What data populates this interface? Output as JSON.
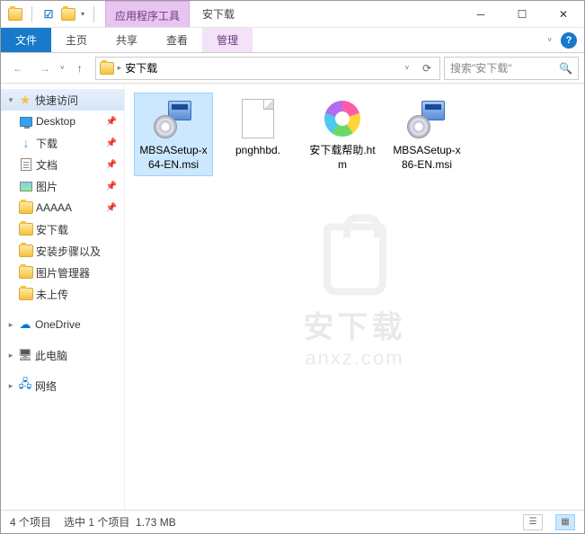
{
  "titlebar": {
    "context_label": "应用程序工具",
    "title": "安下载"
  },
  "ribbon": {
    "file": "文件",
    "home": "主页",
    "share": "共享",
    "view": "查看",
    "manage": "管理"
  },
  "nav": {
    "location": "安下载",
    "search_placeholder": "搜索\"安下载\""
  },
  "sidebar": {
    "quick": "快速访问",
    "items": [
      {
        "label": "Desktop",
        "icon": "desktop",
        "pinned": true
      },
      {
        "label": "下载",
        "icon": "download",
        "pinned": true
      },
      {
        "label": "文档",
        "icon": "doc",
        "pinned": true
      },
      {
        "label": "图片",
        "icon": "pic",
        "pinned": true
      },
      {
        "label": "AAAAA",
        "icon": "folder",
        "pinned": true
      },
      {
        "label": "安下载",
        "icon": "folder",
        "pinned": false
      },
      {
        "label": "安装步骤以及",
        "icon": "folder",
        "pinned": false
      },
      {
        "label": "图片管理器",
        "icon": "folder",
        "pinned": false
      },
      {
        "label": "未上传",
        "icon": "folder",
        "pinned": false
      }
    ],
    "onedrive": "OneDrive",
    "thispc": "此电脑",
    "network": "网络"
  },
  "files": [
    {
      "name": "MBSASetup-x64-EN.msi",
      "type": "msi",
      "selected": true
    },
    {
      "name": "pnghhbd.",
      "type": "blank",
      "selected": false
    },
    {
      "name": "安下载帮助.htm",
      "type": "htm",
      "selected": false
    },
    {
      "name": "MBSASetup-x86-EN.msi",
      "type": "msi",
      "selected": false
    }
  ],
  "status": {
    "count": "4 个项目",
    "selected": "选中 1 个项目",
    "size": "1.73 MB"
  },
  "watermark": {
    "line1": "安下载",
    "line2": "anxz.com"
  }
}
